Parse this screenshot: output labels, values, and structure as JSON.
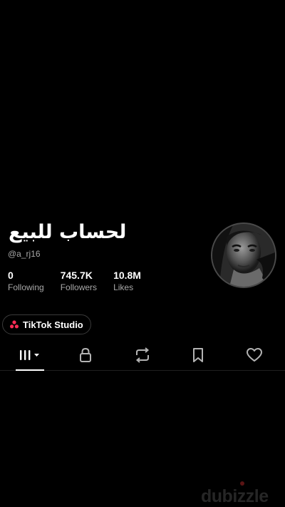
{
  "profile": {
    "display_name": "لحساب للبيع",
    "username": "@a_rj16",
    "avatar_icon": "profile-photo"
  },
  "stats": [
    {
      "value": "0",
      "label": "Following"
    },
    {
      "value": "745.7K",
      "label": "Followers"
    },
    {
      "value": "10.8M",
      "label": "Likes"
    }
  ],
  "studio_button": {
    "label": "TikTok Studio",
    "icon": "people-icon",
    "icon_color": "#fe2c55"
  },
  "tabs": [
    {
      "icon": "grid-icon",
      "active": true
    },
    {
      "icon": "lock-icon",
      "active": false
    },
    {
      "icon": "repost-icon",
      "active": false
    },
    {
      "icon": "bookmark-icon",
      "active": false
    },
    {
      "icon": "heart-icon",
      "active": false
    }
  ],
  "watermark": {
    "text": "dubizzle"
  },
  "colors": {
    "background": "#000000",
    "text_primary": "#ffffff",
    "text_secondary": "#a8a8a8",
    "accent": "#fe2c55"
  }
}
